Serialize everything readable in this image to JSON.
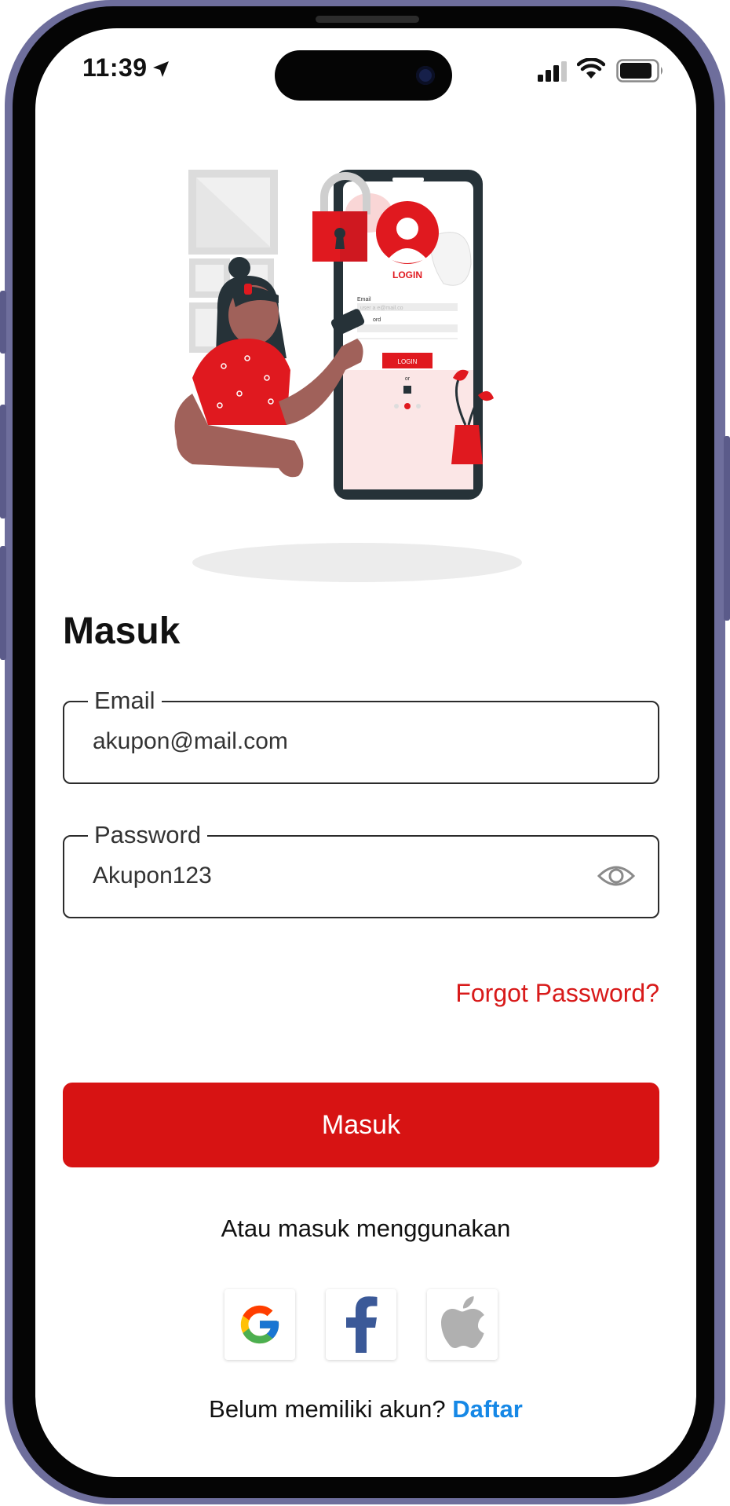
{
  "status_bar": {
    "time": "11:39"
  },
  "icons": {
    "location": "location-arrow-icon",
    "signal": "cellular-signal-icon",
    "wifi": "wifi-icon",
    "battery": "battery-icon",
    "eye": "eye-icon",
    "google": "google-icon",
    "facebook": "facebook-icon",
    "apple": "apple-icon"
  },
  "illustration": {
    "login_text": "LOGIN",
    "email_text": "Email",
    "email_placeholder": "user a e@mail.co",
    "password_text": "ord",
    "or_text": "or"
  },
  "form": {
    "title": "Masuk",
    "email_label": "Email",
    "email_value": "akupon@mail.com",
    "password_label": "Password",
    "password_value": "Akupon123",
    "forgot_label": "Forgot Password?",
    "submit_label": "Masuk"
  },
  "alternate": {
    "label": "Atau masuk menggunakan"
  },
  "signup": {
    "prompt": "Belum memiliki akun?",
    "link": "Daftar"
  },
  "colors": {
    "primary": "#d71313",
    "link": "#1688e6",
    "frame": "#6e6e9c"
  }
}
